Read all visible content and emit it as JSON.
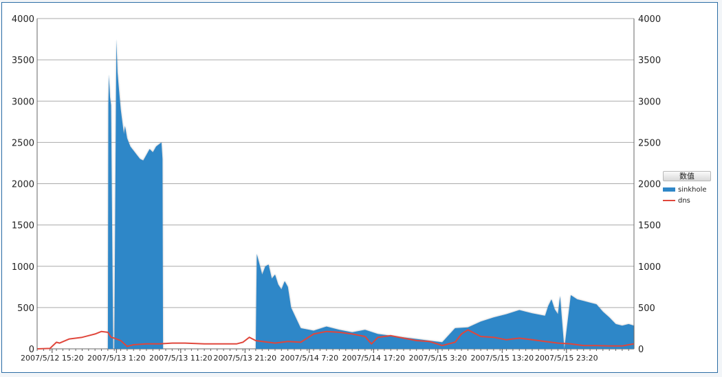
{
  "chart_data": {
    "type": "area",
    "legend": {
      "title": "数值",
      "placement": "right"
    },
    "ylim": [
      0,
      4000
    ],
    "yticks": [
      0,
      500,
      1000,
      1500,
      2000,
      2500,
      3000,
      3500,
      4000
    ],
    "xlim": [
      "2007/5/12 13:00",
      "2007/5/16 9:50"
    ],
    "x_tick_labels": [
      "2007/5/12 15:20",
      "2007/5/13 1:20",
      "2007/5/13 11:20",
      "2007/5/13 21:20",
      "2007/5/14 7:20",
      "2007/5/14 17:20",
      "2007/5/15 3:20",
      "2007/5/15 13:20",
      "2007/5/15 23:20"
    ],
    "grid": true,
    "colors": {
      "sinkhole": "#2f87c8",
      "dns": "#e0463b"
    },
    "series": [
      {
        "name": "sinkhole",
        "type": "area",
        "x": [
          "2007/5/12 13:00",
          "2007/5/13 0:00",
          "2007/5/13 0:05",
          "2007/5/13 0:10",
          "2007/5/13 0:20",
          "2007/5/13 0:30",
          "2007/5/13 0:50",
          "2007/5/13 1:00",
          "2007/5/13 1:20",
          "2007/5/13 1:30",
          "2007/5/13 1:40",
          "2007/5/13 2:00",
          "2007/5/13 2:10",
          "2007/5/13 2:30",
          "2007/5/13 2:40",
          "2007/5/13 3:00",
          "2007/5/13 3:30",
          "2007/5/13 4:00",
          "2007/5/13 4:30",
          "2007/5/13 5:00",
          "2007/5/13 5:30",
          "2007/5/13 6:00",
          "2007/5/13 6:30",
          "2007/5/13 7:00",
          "2007/5/13 7:30",
          "2007/5/13 8:00",
          "2007/5/13 8:20",
          "2007/5/13 8:30",
          "2007/5/13 8:35",
          "2007/5/13 23:00",
          "2007/5/13 23:10",
          "2007/5/13 23:30",
          "2007/5/14 0:00",
          "2007/5/14 0:30",
          "2007/5/14 1:00",
          "2007/5/14 1:30",
          "2007/5/14 2:00",
          "2007/5/14 2:30",
          "2007/5/14 3:00",
          "2007/5/14 3:30",
          "2007/5/14 4:00",
          "2007/5/14 4:30",
          "2007/5/14 6:00",
          "2007/5/14 8:00",
          "2007/5/14 10:00",
          "2007/5/14 12:00",
          "2007/5/14 14:00",
          "2007/5/14 16:00",
          "2007/5/14 18:00",
          "2007/5/14 20:00",
          "2007/5/14 22:00",
          "2007/5/15 0:00",
          "2007/5/15 2:00",
          "2007/5/15 4:00",
          "2007/5/15 6:00",
          "2007/5/15 8:00",
          "2007/5/15 10:00",
          "2007/5/15 12:00",
          "2007/5/15 14:00",
          "2007/5/15 16:00",
          "2007/5/15 18:00",
          "2007/5/15 20:00",
          "2007/5/15 20:30",
          "2007/5/15 21:00",
          "2007/5/15 21:30",
          "2007/5/15 22:00",
          "2007/5/15 22:20",
          "2007/5/15 23:00",
          "2007/5/16 0:00",
          "2007/5/16 1:00",
          "2007/5/16 2:00",
          "2007/5/16 3:00",
          "2007/5/16 4:00",
          "2007/5/16 5:00",
          "2007/5/16 6:00",
          "2007/5/16 7:00",
          "2007/5/16 8:00",
          "2007/5/16 9:00",
          "2007/5/16 9:50"
        ],
        "values": [
          0,
          0,
          2950,
          3320,
          3050,
          2950,
          0,
          0,
          3750,
          3350,
          3200,
          2900,
          2800,
          2600,
          2700,
          2550,
          2450,
          2400,
          2350,
          2300,
          2280,
          2350,
          2420,
          2380,
          2450,
          2480,
          2500,
          2300,
          0,
          0,
          1150,
          1050,
          900,
          1000,
          1020,
          850,
          900,
          780,
          720,
          820,
          750,
          500,
          250,
          220,
          270,
          230,
          200,
          230,
          180,
          160,
          140,
          120,
          100,
          80,
          250,
          260,
          330,
          380,
          420,
          470,
          430,
          400,
          520,
          600,
          480,
          420,
          640,
          0,
          650,
          600,
          580,
          560,
          540,
          450,
          380,
          300,
          280,
          300,
          280
        ]
      },
      {
        "name": "dns",
        "type": "line",
        "x": [
          "2007/5/12 13:00",
          "2007/5/12 15:00",
          "2007/5/12 15:20",
          "2007/5/12 16:00",
          "2007/5/12 16:30",
          "2007/5/12 18:00",
          "2007/5/12 20:00",
          "2007/5/12 22:00",
          "2007/5/12 23:00",
          "2007/5/13 0:00",
          "2007/5/13 0:30",
          "2007/5/13 1:00",
          "2007/5/13 2:00",
          "2007/5/13 3:00",
          "2007/5/13 4:00",
          "2007/5/13 6:00",
          "2007/5/13 8:00",
          "2007/5/13 10:00",
          "2007/5/13 12:00",
          "2007/5/13 15:00",
          "2007/5/13 18:00",
          "2007/5/13 20:00",
          "2007/5/13 21:00",
          "2007/5/13 22:00",
          "2007/5/13 23:00",
          "2007/5/14 0:00",
          "2007/5/14 2:00",
          "2007/5/14 4:00",
          "2007/5/14 6:00",
          "2007/5/14 8:00",
          "2007/5/14 10:00",
          "2007/5/14 12:00",
          "2007/5/14 14:00",
          "2007/5/14 16:00",
          "2007/5/14 17:00",
          "2007/5/14 18:00",
          "2007/5/14 20:00",
          "2007/5/14 22:00",
          "2007/5/15 0:00",
          "2007/5/15 2:00",
          "2007/5/15 4:00",
          "2007/5/15 6:00",
          "2007/5/15 7:00",
          "2007/5/15 8:00",
          "2007/5/15 10:00",
          "2007/5/15 12:00",
          "2007/5/15 14:00",
          "2007/5/15 16:00",
          "2007/5/15 18:00",
          "2007/5/15 20:00",
          "2007/5/15 22:00",
          "2007/5/16 0:00",
          "2007/5/16 2:00",
          "2007/5/16 4:00",
          "2007/5/16 6:00",
          "2007/5/16 8:00",
          "2007/5/16 9:00",
          "2007/5/16 9:50"
        ],
        "values": [
          0,
          5,
          30,
          80,
          70,
          120,
          140,
          180,
          210,
          200,
          140,
          130,
          100,
          30,
          50,
          60,
          60,
          70,
          70,
          60,
          60,
          60,
          80,
          140,
          100,
          90,
          70,
          90,
          80,
          180,
          210,
          200,
          180,
          150,
          60,
          140,
          160,
          130,
          100,
          90,
          40,
          80,
          180,
          230,
          150,
          140,
          110,
          130,
          110,
          90,
          70,
          60,
          40,
          40,
          35,
          35,
          50,
          60
        ]
      }
    ]
  }
}
